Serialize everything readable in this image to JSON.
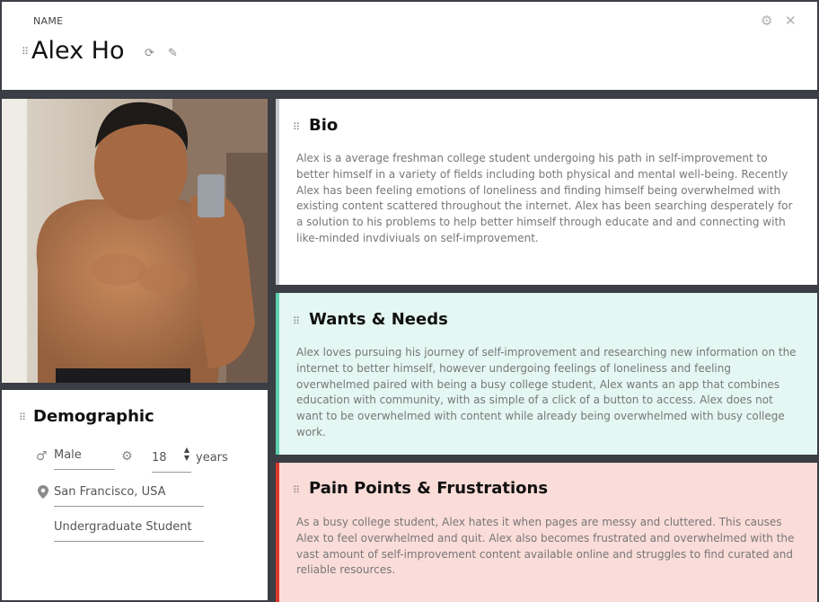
{
  "header": {
    "section_label": "NAME",
    "persona_name": "Alex Ho"
  },
  "icons": {
    "drag": "drag-handle-icon",
    "refresh": "refresh-icon",
    "edit": "pencil-icon",
    "settings": "gear-icon",
    "close": "close-icon",
    "gender": "male-icon",
    "location": "location-pin-icon",
    "stepper": "stepper-arrows-icon"
  },
  "demographic": {
    "title": "Demographic",
    "gender": "Male",
    "age": "18",
    "age_unit": "years",
    "location": "San Francisco, USA",
    "occupation": "Undergraduate Student"
  },
  "bio": {
    "title": "Bio",
    "text": "Alex is a average freshman college student undergoing his path in self-improvement to better himself in a variety of fields including both physical and mental well-being. Recently Alex has been feeling emotions of loneliness and finding himself being overwhelmed with existing content scattered throughout the internet. Alex has been searching desperately for a solution to his problems to help better himself through educate and and connecting with like-minded invdiviuals on self-improvement."
  },
  "wants": {
    "title": "Wants & Needs",
    "text": "Alex loves pursuing his journey of self-improvement and researching new information on the internet to better himself, however undergoing feelings of loneliness and feeling overwhelmed paired with being a busy college student, Alex wants an app that combines education with community, with as simple of a click of a button to access. Alex does not want to be overwhelmed with content while already being overwhelmed with busy college work."
  },
  "pain": {
    "title": "Pain Points & Frustrations",
    "text": "As a busy college student, Alex hates it when pages are messy and cluttered. This causes Alex to feel overwhelmed and quit. Alex also becomes frustrated and overwhelmed with the vast amount of self-improvement content available online and struggles to find curated and reliable resources."
  },
  "colors": {
    "background": "#3b3e44",
    "bio_accent": "#c7c9d0",
    "wants_accent": "#5ecfb0",
    "wants_background": "#e4f7f2",
    "pain_accent": "#d9382a",
    "pain_background": "#fadcd8"
  }
}
